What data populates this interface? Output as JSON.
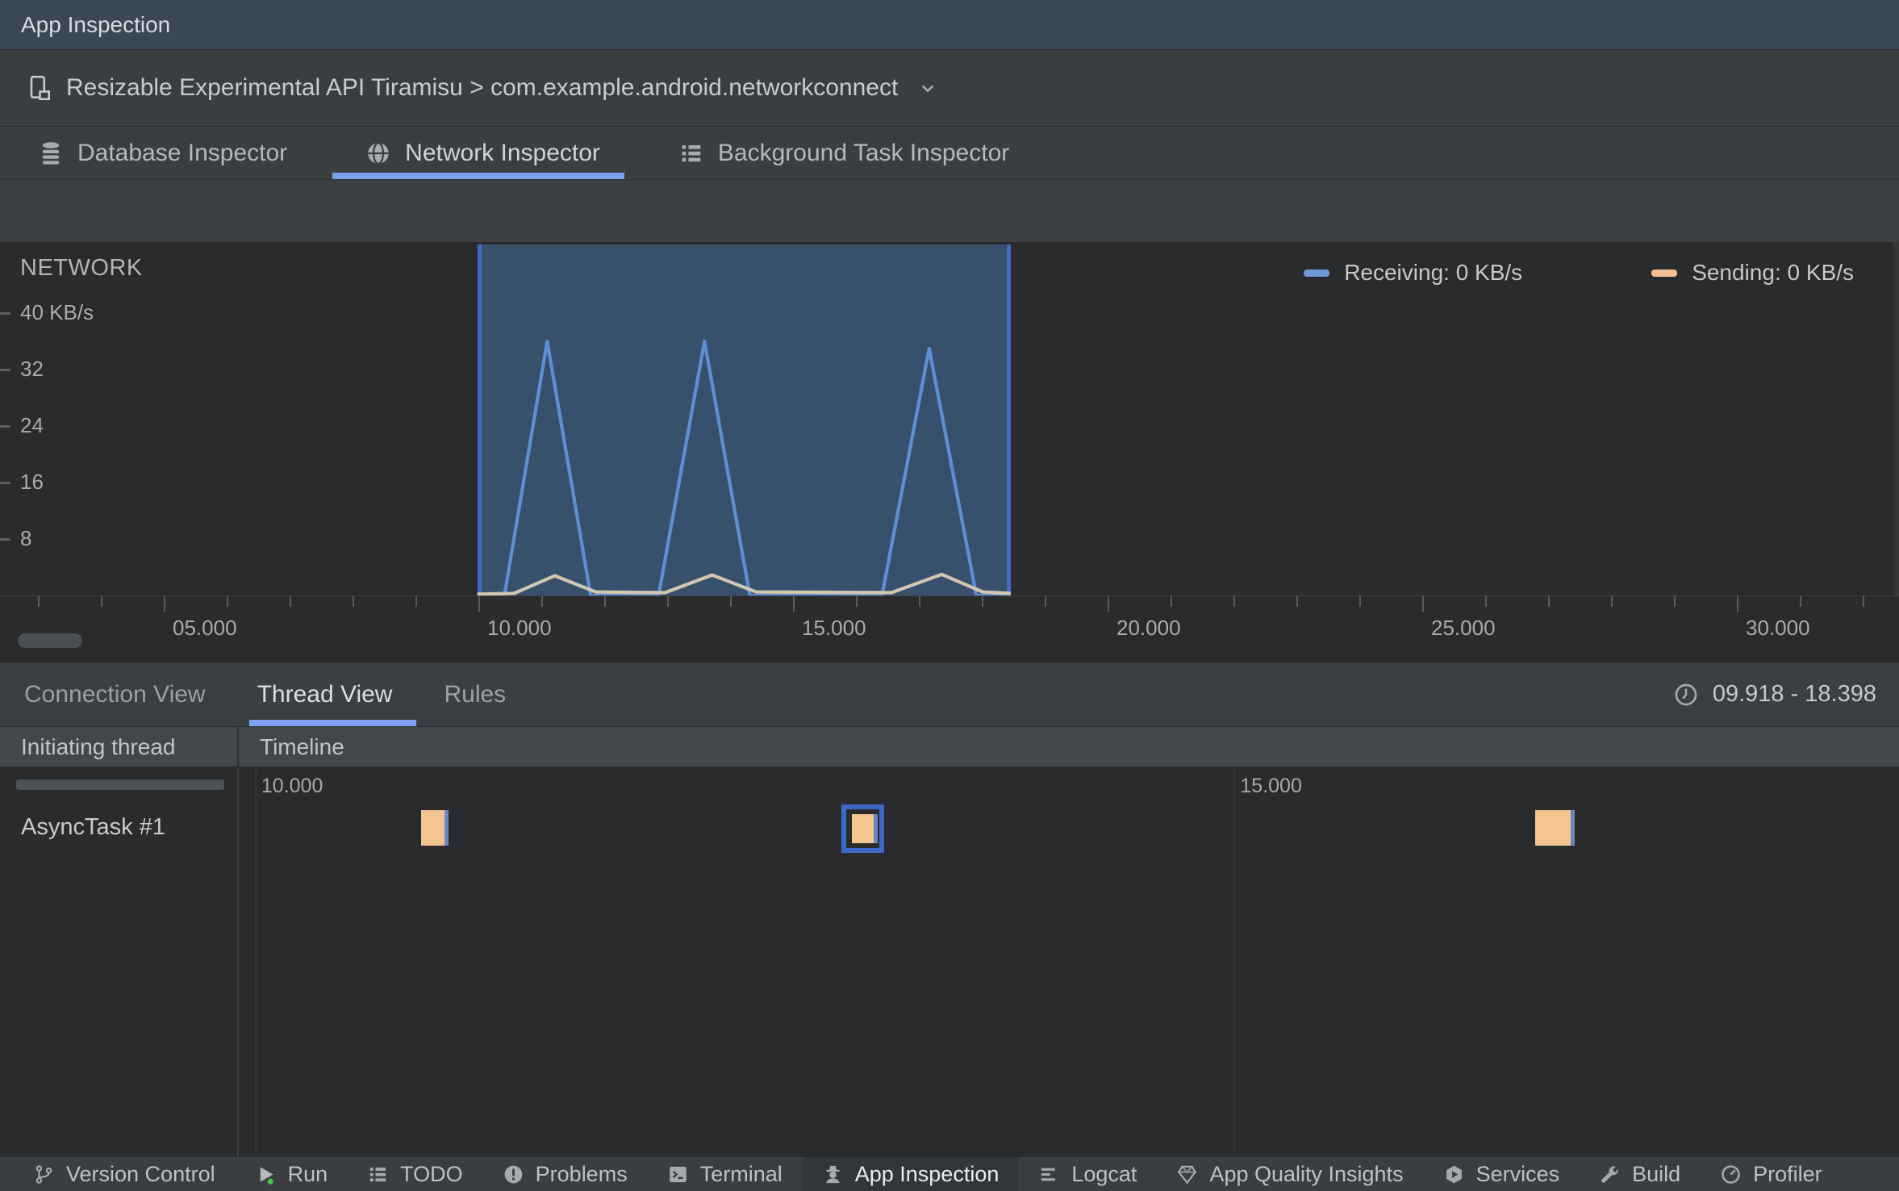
{
  "titlebar": {
    "title": "App Inspection"
  },
  "device_bar": {
    "label": "Resizable Experimental API Tiramisu > com.example.android.networkconnect",
    "icon": "device-icon",
    "chevron": "chevron-down-icon"
  },
  "inspector_tabs": [
    {
      "label": "Database Inspector",
      "icon": "database-icon",
      "active": false
    },
    {
      "label": "Network Inspector",
      "icon": "globe-icon",
      "active": true
    },
    {
      "label": "Background Task Inspector",
      "icon": "task-list-icon",
      "active": false
    }
  ],
  "chart_data": {
    "type": "area",
    "title": "NETWORK",
    "ylabel": "KB/s",
    "ylim": [
      0,
      50
    ],
    "xlim_seconds": [
      2.33,
      32.5
    ],
    "grid": false,
    "legend_position": "top-right",
    "y_axis": {
      "ticks": [
        {
          "value": 40,
          "label": "40 KB/s"
        },
        {
          "value": 32,
          "label": "32"
        },
        {
          "value": 24,
          "label": "24"
        },
        {
          "value": 16,
          "label": "16"
        },
        {
          "value": 8,
          "label": "8"
        }
      ]
    },
    "x_axis": {
      "ticks": [
        {
          "t": 5,
          "label": "05.000"
        },
        {
          "t": 10,
          "label": "10.000"
        },
        {
          "t": 15,
          "label": "15.000"
        },
        {
          "t": 20,
          "label": "20.000"
        },
        {
          "t": 25,
          "label": "25.000"
        },
        {
          "t": 30,
          "label": "30.000"
        }
      ]
    },
    "selection": {
      "start": 9.918,
      "end": 18.398
    },
    "legend": [
      {
        "label": "Receiving: 0 KB/s",
        "color": "#6e9bd8"
      },
      {
        "label": "Sending: 0 KB/s",
        "color": "#f2be92"
      }
    ],
    "series": [
      {
        "name": "Receiving",
        "current": "0 KB/s",
        "color": "#5c8fd8",
        "points": [
          [
            9.918,
            0
          ],
          [
            10.35,
            0
          ],
          [
            11.03,
            36
          ],
          [
            11.72,
            0
          ],
          [
            12.8,
            0
          ],
          [
            13.53,
            36
          ],
          [
            14.25,
            0
          ],
          [
            16.35,
            0
          ],
          [
            17.1,
            35
          ],
          [
            17.85,
            0
          ],
          [
            18.398,
            0
          ]
        ]
      },
      {
        "name": "Sending",
        "current": "0 KB/s",
        "color": "#d2c6af",
        "points": [
          [
            9.918,
            0.2
          ],
          [
            10.5,
            0.3
          ],
          [
            11.15,
            2.8
          ],
          [
            11.8,
            0.5
          ],
          [
            12.9,
            0.4
          ],
          [
            13.65,
            2.9
          ],
          [
            14.35,
            0.5
          ],
          [
            16.5,
            0.4
          ],
          [
            17.3,
            3.0
          ],
          [
            17.95,
            0.5
          ],
          [
            18.398,
            0.3
          ]
        ]
      }
    ]
  },
  "view_tabs": [
    {
      "label": "Connection View",
      "active": false
    },
    {
      "label": "Thread View",
      "active": true
    },
    {
      "label": "Rules",
      "active": false
    }
  ],
  "time_range": {
    "icon": "clock-icon",
    "label": "09.918 - 18.398"
  },
  "table": {
    "columns": [
      "Initiating thread",
      "Timeline"
    ],
    "ruler_ticks": [
      {
        "t": 10,
        "label": "10.000"
      },
      {
        "t": 15,
        "label": "15.000"
      }
    ],
    "rows": [
      {
        "thread": "AsyncTask #1",
        "blocks": [
          {
            "start": 10.85,
            "end": 10.97,
            "selected": false
          },
          {
            "start": 13.05,
            "end": 13.16,
            "selected": true
          },
          {
            "start": 16.54,
            "end": 16.72,
            "selected": false
          }
        ]
      }
    ]
  },
  "statusbar": {
    "items": [
      {
        "label": "Version Control",
        "icon": "version-control-icon",
        "active": false
      },
      {
        "label": "Run",
        "icon": "run-icon",
        "active": false
      },
      {
        "label": "TODO",
        "icon": "todo-icon",
        "active": false
      },
      {
        "label": "Problems",
        "icon": "problems-icon",
        "active": false
      },
      {
        "label": "Terminal",
        "icon": "terminal-icon",
        "active": false
      },
      {
        "label": "App Inspection",
        "icon": "app-inspection-icon",
        "active": true
      },
      {
        "label": "Logcat",
        "icon": "logcat-icon",
        "active": false
      },
      {
        "label": "App Quality Insights",
        "icon": "gem-icon",
        "active": false
      },
      {
        "label": "Services",
        "icon": "services-icon",
        "active": false
      },
      {
        "label": "Build",
        "icon": "build-icon",
        "active": false
      },
      {
        "label": "Profiler",
        "icon": "profiler-icon",
        "active": false
      }
    ]
  },
  "colors": {
    "accent_underline": "#7ca1f0",
    "selection_fill": "#37506c",
    "selection_border": "#3e6cc9",
    "block_orange": "#f4c491",
    "block_blue_sliver": "#6c87be",
    "selected_ring_blue": "#3d68c8",
    "run_green": "#43c944",
    "titlebar_bg": "#3b4754",
    "panel_bg": "#3c3f41",
    "chart_bg": "#2a2b2d"
  }
}
